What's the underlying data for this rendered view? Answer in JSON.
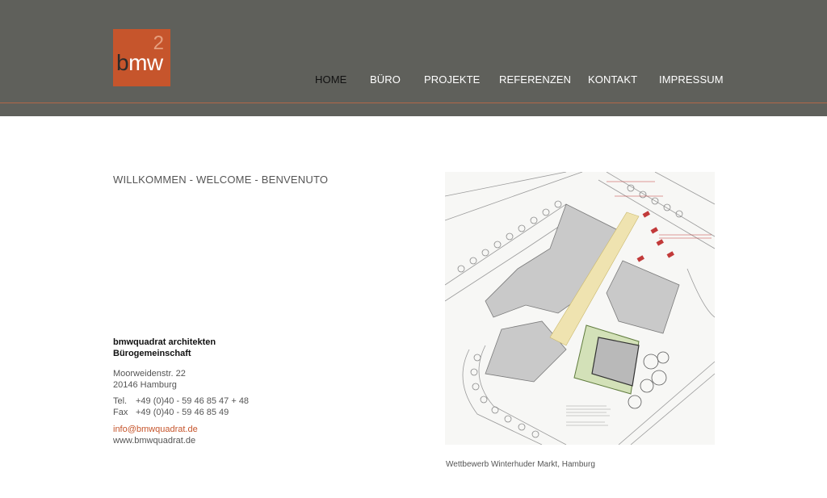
{
  "logo": {
    "text_b": "b",
    "text_rest": "mw",
    "superscript": "2",
    "color": "#c6552c"
  },
  "nav": {
    "items": [
      {
        "label": "HOME",
        "active": true
      },
      {
        "label": "BÜRO"
      },
      {
        "label": "PROJEKTE"
      },
      {
        "label": "REFERENZEN"
      },
      {
        "label": "KONTAKT"
      },
      {
        "label": "IMPRESSUM"
      }
    ]
  },
  "main": {
    "welcome": "WILLKOMMEN - WELCOME - BENVENUTO",
    "company_line1": "bmwquadrat architekten",
    "company_line2": "Bürogemeinschaft",
    "street": "Moorweidenstr. 22",
    "city": "20146 Hamburg",
    "tel_label": "Tel.",
    "tel_value": "+49 (0)40 - 59 46 85 47 + 48",
    "fax_label": "Fax",
    "fax_value": "+49 (0)40 - 59 46 85 49",
    "email": "info@bmwquadrat.de",
    "website": "www.bmwquadrat.de"
  },
  "image": {
    "caption": "Wettbewerb Winterhuder Markt, Hamburg",
    "icon": "site-plan-image"
  },
  "colors": {
    "header_bg": "#5f605b",
    "accent": "#c6552c",
    "text_gray": "#555555"
  }
}
